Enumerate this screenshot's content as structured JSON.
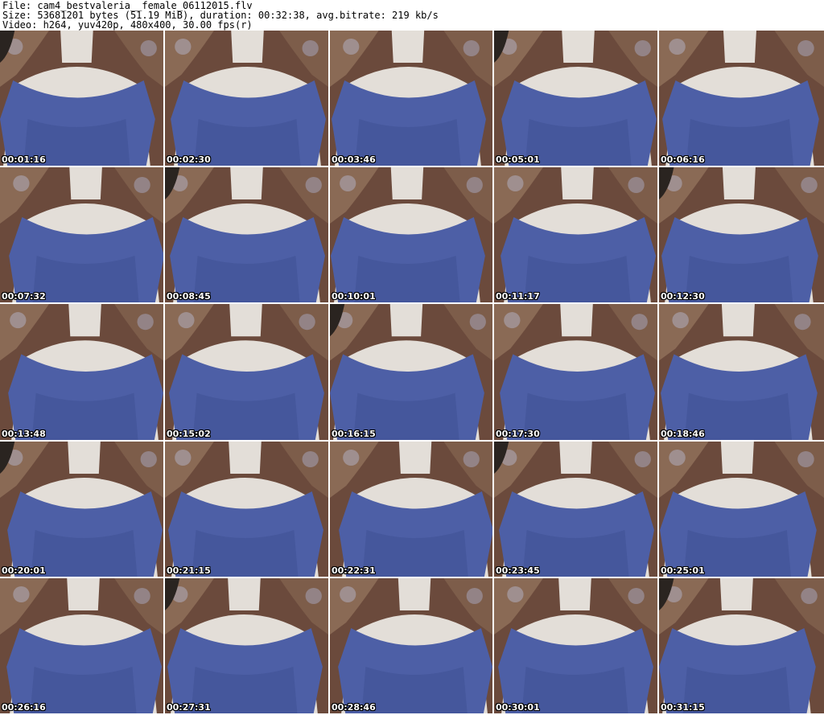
{
  "header": {
    "file_line": "File: cam4_bestvaleria__female_06112015.flv",
    "size_line": "Size: 53681201 bytes (51.19 MiB), duration: 00:32:38, avg.bitrate: 219 kb/s",
    "video_line": "Video: h264, yuv420p, 480x400, 30.00 fps(r)"
  },
  "thumbnails": [
    {
      "time": "00:01:16"
    },
    {
      "time": "00:02:30"
    },
    {
      "time": "00:03:46"
    },
    {
      "time": "00:05:01"
    },
    {
      "time": "00:06:16"
    },
    {
      "time": "00:07:32"
    },
    {
      "time": "00:08:45"
    },
    {
      "time": "00:10:01"
    },
    {
      "time": "00:11:17"
    },
    {
      "time": "00:12:30"
    },
    {
      "time": "00:13:48"
    },
    {
      "time": "00:15:02"
    },
    {
      "time": "00:16:15"
    },
    {
      "time": "00:17:30"
    },
    {
      "time": "00:18:46"
    },
    {
      "time": "00:20:01"
    },
    {
      "time": "00:21:15"
    },
    {
      "time": "00:22:31"
    },
    {
      "time": "00:23:45"
    },
    {
      "time": "00:25:01"
    },
    {
      "time": "00:26:16"
    },
    {
      "time": "00:27:31"
    },
    {
      "time": "00:28:46"
    },
    {
      "time": "00:30:01"
    },
    {
      "time": "00:31:15"
    }
  ],
  "colors": {
    "background": "#ffffff",
    "header_text": "#000000",
    "timestamp_text": "#ffffff",
    "timestamp_outline": "#000000",
    "shirt": "#4d5fa6",
    "shirt_shadow": "#3e4f92",
    "skin": "#e3ded8",
    "hair": "#2a2420",
    "furniture": "#6b4a3c"
  }
}
